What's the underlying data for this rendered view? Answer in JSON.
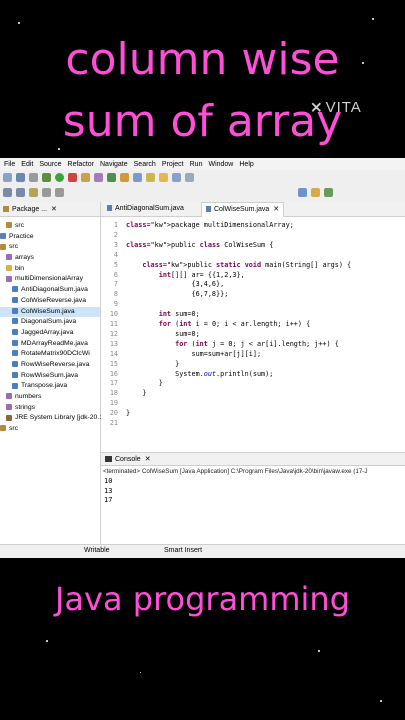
{
  "overlay": {
    "title_line1": "column wise",
    "title_line2": "sum of array",
    "watermark": "VITA",
    "bottom_title": "Java programming",
    "accent_color": "#ff4fd8"
  },
  "ide": {
    "menu": [
      "File",
      "Edit",
      "Source",
      "Refactor",
      "Navigate",
      "Search",
      "Project",
      "Run",
      "Window",
      "Help"
    ],
    "package_tab": "Package ...",
    "tree": [
      {
        "label": "src",
        "indent": 1,
        "icon": "source-folder"
      },
      {
        "label": "Practice",
        "indent": 0,
        "icon": "project"
      },
      {
        "label": "src",
        "indent": 0,
        "icon": "source-folder"
      },
      {
        "label": "arrays",
        "indent": 1,
        "icon": "package"
      },
      {
        "label": "bin",
        "indent": 1,
        "icon": "folder"
      },
      {
        "label": "multiDimensionalArray",
        "indent": 1,
        "icon": "package"
      },
      {
        "label": "AntiDiagonalSum.java",
        "indent": 2,
        "icon": "java-file"
      },
      {
        "label": "ColWiseReverse.java",
        "indent": 2,
        "icon": "java-file"
      },
      {
        "label": "ColWiseSum.java",
        "indent": 2,
        "icon": "java-file",
        "selected": true
      },
      {
        "label": "DiagonalSum.java",
        "indent": 2,
        "icon": "java-file"
      },
      {
        "label": "JaggedArray.java",
        "indent": 2,
        "icon": "java-file"
      },
      {
        "label": "MDArrayReadMe.java",
        "indent": 2,
        "icon": "java-file"
      },
      {
        "label": "RotateMatrix90DClcWi",
        "indent": 2,
        "icon": "java-file"
      },
      {
        "label": "RowWiseReverse.java",
        "indent": 2,
        "icon": "java-file"
      },
      {
        "label": "RowWiseSum.java",
        "indent": 2,
        "icon": "java-file"
      },
      {
        "label": "Transpose.java",
        "indent": 2,
        "icon": "java-file"
      },
      {
        "label": "numbers",
        "indent": 1,
        "icon": "package"
      },
      {
        "label": "strings",
        "indent": 1,
        "icon": "package"
      },
      {
        "label": "JRE System Library [jdk-20.1]",
        "indent": 1,
        "icon": "library"
      },
      {
        "label": "src",
        "indent": 0,
        "icon": "source-folder"
      }
    ],
    "editor_tabs": [
      "AntiDiagonalSum.java",
      "ColWiseSum.java"
    ],
    "code_lines": [
      {
        "n": "1",
        "text": "package multiDimensionalArray;"
      },
      {
        "n": "2",
        "text": ""
      },
      {
        "n": "3",
        "text": "public class ColWiseSum {"
      },
      {
        "n": "4",
        "text": ""
      },
      {
        "n": "5",
        "text": "    public static void main(String[] args) {"
      },
      {
        "n": "6",
        "text": "        int[][] ar= {{1,2,3},"
      },
      {
        "n": "7",
        "text": "                {3,4,6},"
      },
      {
        "n": "8",
        "text": "                {6,7,8}};"
      },
      {
        "n": "9",
        "text": ""
      },
      {
        "n": "10",
        "text": "        int sum=0;"
      },
      {
        "n": "11",
        "text": "        for (int i = 0; i < ar.length; i++) {"
      },
      {
        "n": "12",
        "text": "            sum=0;"
      },
      {
        "n": "13",
        "text": "            for (int j = 0; j < ar[i].length; j++) {"
      },
      {
        "n": "14",
        "text": "                sum=sum+ar[j][i];"
      },
      {
        "n": "15",
        "text": "            }"
      },
      {
        "n": "16",
        "text": "            System.out.println(sum);"
      },
      {
        "n": "17",
        "text": "        }"
      },
      {
        "n": "18",
        "text": "    }"
      },
      {
        "n": "19",
        "text": ""
      },
      {
        "n": "20",
        "text": "}"
      },
      {
        "n": "21",
        "text": ""
      }
    ],
    "console_tab": "Console",
    "console_header": "<terminated> ColWiseSum [Java Application] C:\\Program Files\\Java\\jdk-20\\bin\\javaw.exe  (17-J",
    "console_output": [
      "10",
      "13",
      "17"
    ],
    "status_writable": "Writable",
    "status_insert": "Smart Insert"
  }
}
